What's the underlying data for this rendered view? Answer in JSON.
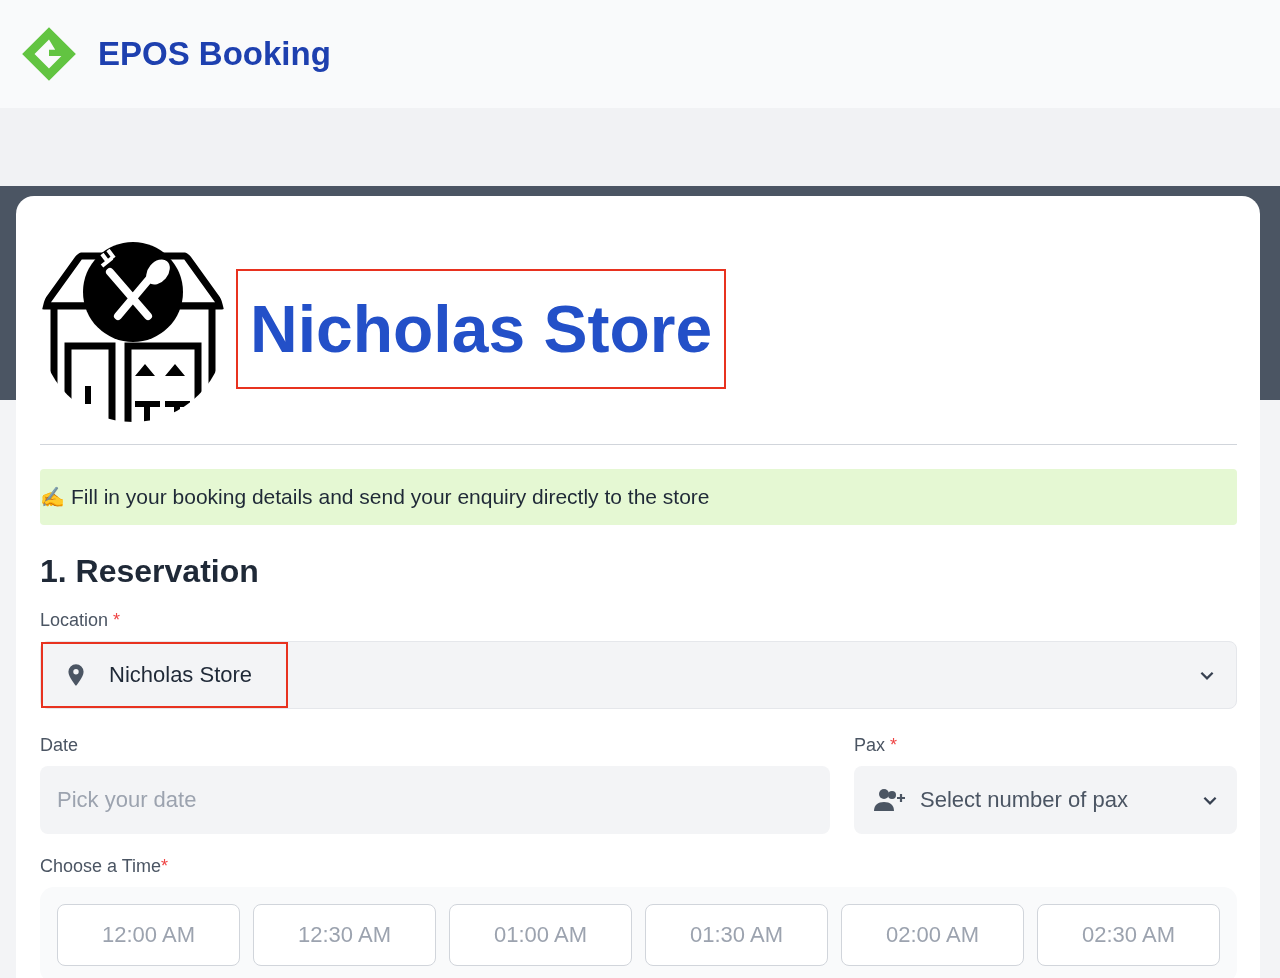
{
  "header": {
    "brand": "EPOS Booking"
  },
  "store": {
    "name": "Nicholas Store",
    "highlighted": true
  },
  "notice": {
    "emoji": "✍️",
    "text": "Fill in your booking details and send your enquiry directly to the store"
  },
  "section_title": "1. Reservation",
  "location": {
    "label": "Location",
    "required_mark": "*",
    "value": "Nicholas Store",
    "highlighted": true
  },
  "date": {
    "label": "Date",
    "placeholder": "Pick your date"
  },
  "pax": {
    "label": "Pax",
    "required_mark": "*",
    "placeholder": "Select number of pax"
  },
  "time": {
    "label": "Choose a Time",
    "required_mark": "*",
    "slots": [
      {
        "label": "12:00 AM",
        "disabled": true
      },
      {
        "label": "12:30 AM",
        "disabled": true
      },
      {
        "label": "01:00 AM",
        "disabled": true
      },
      {
        "label": "01:30 AM",
        "disabled": true
      },
      {
        "label": "02:00 AM",
        "disabled": true
      },
      {
        "label": "02:30 AM",
        "disabled": true
      }
    ]
  }
}
